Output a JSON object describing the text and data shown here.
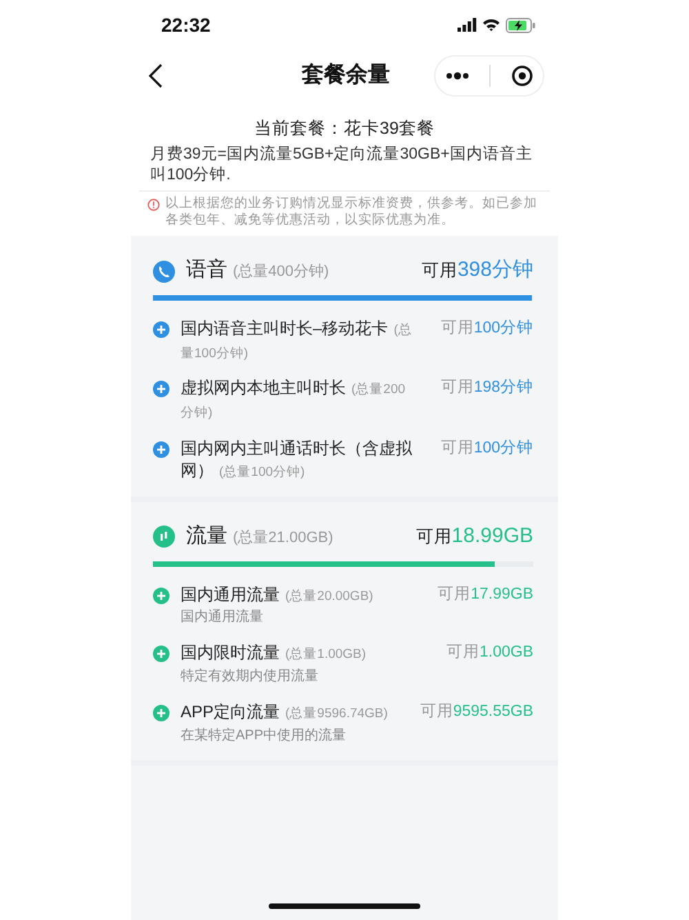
{
  "status_bar": {
    "time": "22:32"
  },
  "nav": {
    "title": "套餐余量"
  },
  "plan": {
    "title": "当前套餐：花卡39套餐",
    "description": "月费39元=国内流量5GB+定向流量30GB+国内语音主叫100分钟.",
    "notice": "以上根据您的业务订购情况显示标准资费，供参考。如已参加各类包年、减免等优惠活动，以实际优惠为准。"
  },
  "sections": [
    {
      "kind": "voice",
      "title": "语音",
      "total": "(总量400分钟)",
      "available_label": "可用",
      "available_value": "398分钟",
      "level": 0.995,
      "color": "#2f8fe0",
      "items": [
        {
          "name": "国内语音主叫时长–移动花卡",
          "total": "(总量100分钟)",
          "available_label": "可用",
          "available_value": "100分钟"
        },
        {
          "name": "虚拟网内本地主叫时长",
          "total": "(总量200分钟)",
          "available_label": "可用",
          "available_value": "198分钟"
        },
        {
          "name": "国内网内主叫通话时长（含虚拟网）",
          "total": "(总量100分钟)",
          "available_label": "可用",
          "available_value": "100分钟"
        }
      ]
    },
    {
      "kind": "data",
      "title": "流量",
      "total": "(总量21.00GB)",
      "available_label": "可用",
      "available_value": "18.99GB",
      "level": 0.9,
      "color": "#25bf8a",
      "items": [
        {
          "name": "国内通用流量",
          "total": "(总量20.00GB)",
          "note": "国内通用流量",
          "available_label": "可用",
          "available_value": "17.99GB"
        },
        {
          "name": "国内限时流量",
          "total": "(总量1.00GB)",
          "note": "特定有效期内使用流量",
          "available_label": "可用",
          "available_value": "1.00GB"
        },
        {
          "name": "APP定向流量",
          "total": "(总量9596.74GB)",
          "note": "在某特定APP中使用的流量",
          "available_label": "可用",
          "available_value": "9595.55GB"
        }
      ]
    }
  ]
}
